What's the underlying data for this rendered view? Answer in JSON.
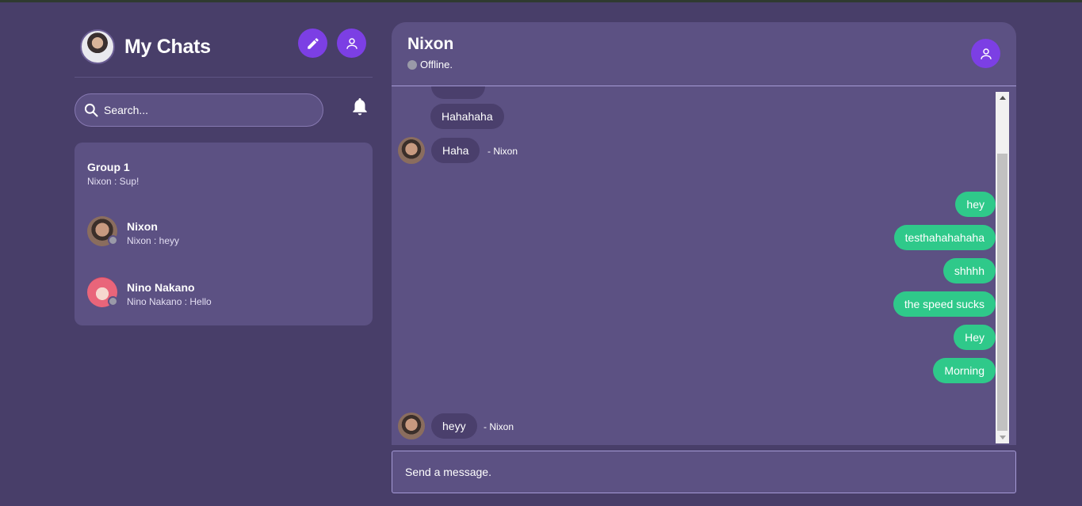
{
  "sidebar": {
    "title": "My Chats",
    "search": {
      "placeholder": "Search..."
    },
    "chats": [
      {
        "name": "Group 1",
        "preview": "Nixon : Sup!"
      },
      {
        "name": "Nixon",
        "preview": "Nixon : heyy"
      },
      {
        "name": "Nino Nakano",
        "preview": "Nino Nakano : Hello"
      }
    ]
  },
  "chat": {
    "name": "Nixon",
    "status": "Offline.",
    "messages": [
      {
        "text": "Hahahaha",
        "direction": "in"
      },
      {
        "text": "Haha",
        "direction": "in",
        "sender": "- Nixon"
      },
      {
        "text": "hey",
        "direction": "out"
      },
      {
        "text": "testhahahahaha",
        "direction": "out"
      },
      {
        "text": "shhhh",
        "direction": "out"
      },
      {
        "text": "the speed sucks",
        "direction": "out"
      },
      {
        "text": "Hey",
        "direction": "out"
      },
      {
        "text": "Morning",
        "direction": "out"
      },
      {
        "text": "heyy",
        "direction": "in",
        "sender": "- Nixon"
      }
    ],
    "composer": {
      "placeholder": "Send a message."
    }
  },
  "colors": {
    "background": "#483e69",
    "panel": "#5c5183",
    "accent": "#7c3fe4",
    "outgoing": "#2fc98a",
    "incoming": "#4a3f6c",
    "offline": "#9a9aa8"
  },
  "icons": [
    "pencil-icon",
    "user-icon",
    "search-icon",
    "bell-icon",
    "scroll-up-arrow-icon",
    "scroll-down-arrow-icon"
  ]
}
